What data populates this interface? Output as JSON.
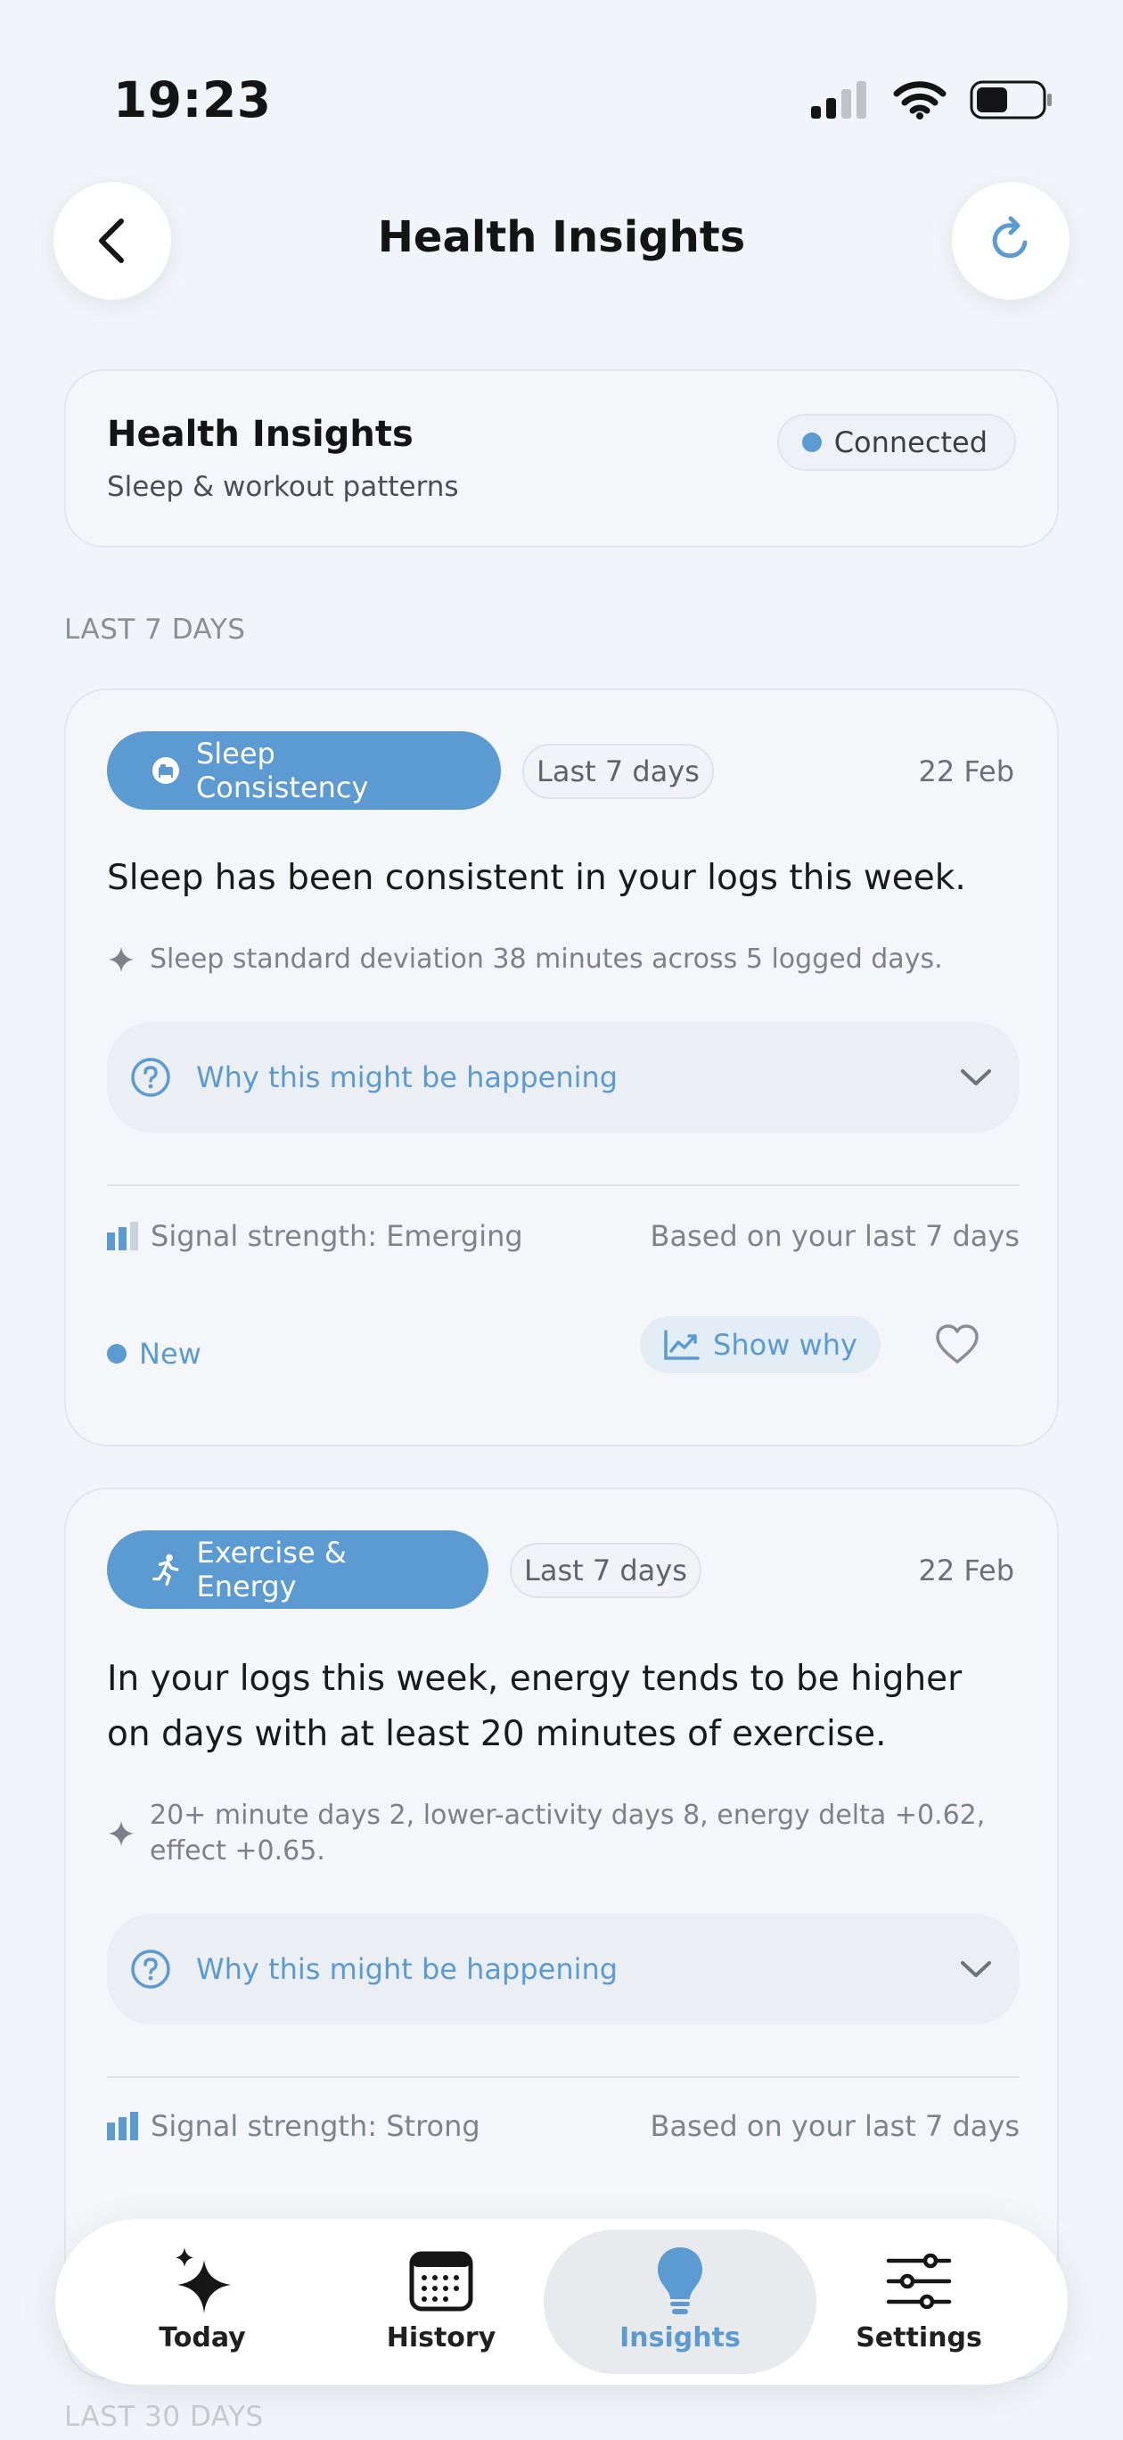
{
  "status_bar": {
    "time": "19:23"
  },
  "header": {
    "title": "Health Insights"
  },
  "summary": {
    "title": "Health Insights",
    "subtitle": "Sleep & workout patterns",
    "status": "Connected"
  },
  "sections": [
    {
      "label": "LAST 7 DAYS"
    },
    {
      "label": "LAST 30 DAYS"
    }
  ],
  "insights": [
    {
      "category": "Sleep Consistency",
      "category_icon": "bed-icon",
      "period": "Last 7 days",
      "date": "22 Feb",
      "main": "Sleep has been consistent in your logs this week.",
      "detail": "Sleep standard deviation 38 minutes across 5 logged days.",
      "why_label": "Why this might be happening",
      "signal": "Signal strength: Emerging",
      "signal_level": 2,
      "based_on": "Based on your last 7 days",
      "status": "New",
      "show_why": "Show why"
    },
    {
      "category": "Exercise & Energy",
      "category_icon": "running-icon",
      "period": "Last 7 days",
      "date": "22 Feb",
      "main": "In your logs this week, energy tends to be higher on days with at least 20 minutes of exercise.",
      "detail": "20+ minute days 2, lower-activity days 8, energy delta +0.62, effect +0.65.",
      "why_label": "Why this might be happening",
      "signal": "Signal strength: Strong",
      "signal_level": 3,
      "based_on": "Based on your last 7 days"
    }
  ],
  "tabs": [
    {
      "label": "Today",
      "icon": "sparkles-icon",
      "active": false
    },
    {
      "label": "History",
      "icon": "calendar-icon",
      "active": false
    },
    {
      "label": "Insights",
      "icon": "lightbulb-icon",
      "active": true
    },
    {
      "label": "Settings",
      "icon": "sliders-icon",
      "active": false
    }
  ],
  "colors": {
    "accent": "#5b9bd2",
    "background": "#f1f4f8",
    "card": "#f4f6f9"
  }
}
